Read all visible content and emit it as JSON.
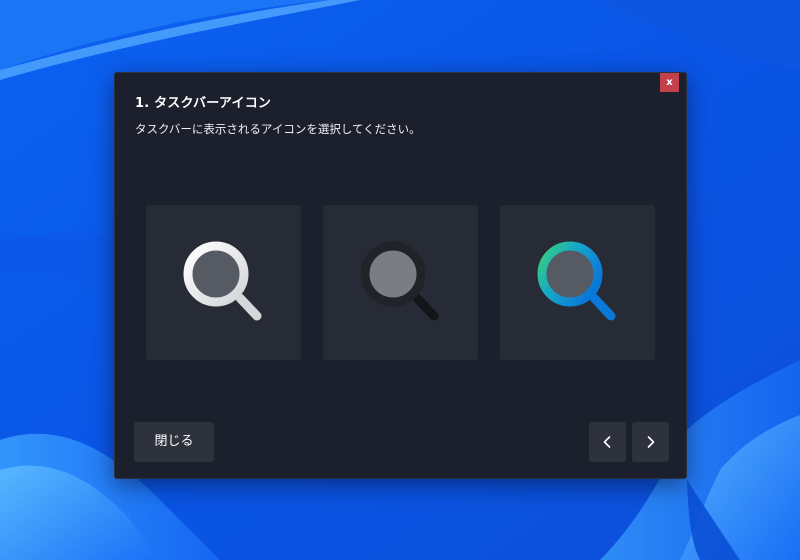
{
  "dialog": {
    "close_label": "x",
    "title": "1. タスクバーアイコン",
    "subtitle": "タスクバーに表示されるアイコンを選択してください。",
    "options": [
      {
        "icon": "magnifier-light-icon"
      },
      {
        "icon": "magnifier-dark-icon"
      },
      {
        "icon": "magnifier-color-icon"
      }
    ],
    "close_button_label": "閉じる",
    "prev_icon": "chevron-left-icon",
    "next_icon": "chevron-right-icon"
  },
  "colors": {
    "dialog_bg": "#1b202c",
    "tile_bg": "#262b36",
    "button_bg": "#2d323d",
    "close_red": "#c4404b",
    "wallpaper_blue": "#0a5ff0"
  }
}
